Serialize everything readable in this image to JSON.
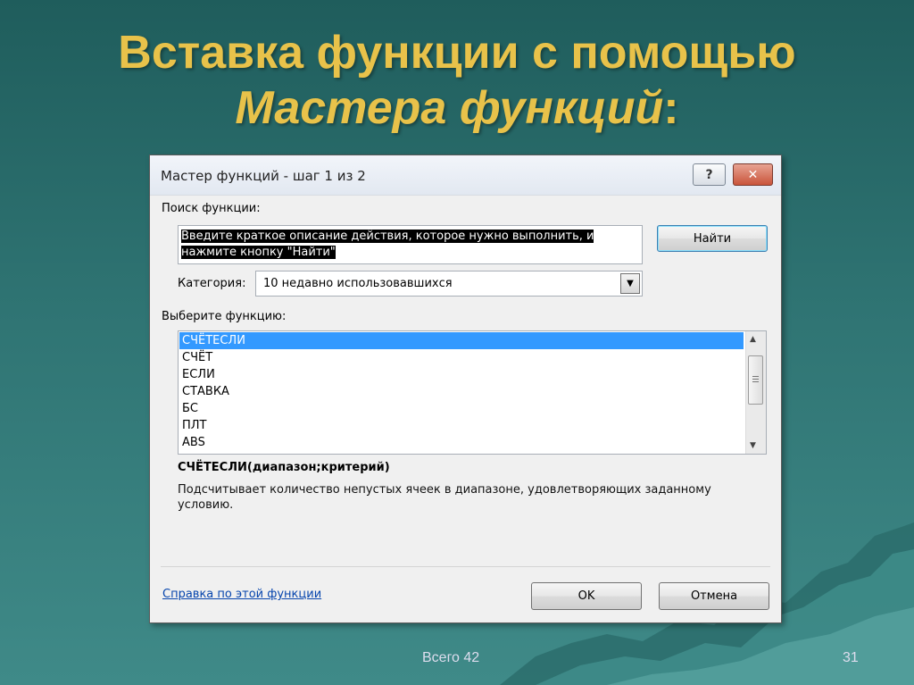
{
  "slide": {
    "title_line1": "Вставка функции с помощью",
    "title_line2": "Мастера функций",
    "title_colon": ":",
    "footer_total": "Всего 42",
    "page_number": "31"
  },
  "dialog": {
    "title": "Мастер функций - шаг 1 из 2",
    "help_button": "?",
    "close_button": "✕",
    "search_label": "Поиск функции:",
    "search_text_line1": "Введите краткое описание действия, которое нужно выполнить, и",
    "search_text_line2": "нажмите кнопку \"Найти\"",
    "find_button": "Найти",
    "category_label": "Категория:",
    "category_value": "10 недавно использовавшихся",
    "choose_label": "Выберите функцию:",
    "functions": [
      "СЧЁТЕСЛИ",
      "СЧЁТ",
      "ЕСЛИ",
      "СТАВКА",
      "БС",
      "ПЛТ",
      "ABS"
    ],
    "signature": "СЧЁТЕСЛИ(диапазон;критерий)",
    "description": "Подсчитывает количество непустых ячеек в диапазоне, удовлетворяющих заданному условию.",
    "help_link": "Справка по этой функции",
    "ok_button": "OK",
    "cancel_button": "Отмена"
  }
}
